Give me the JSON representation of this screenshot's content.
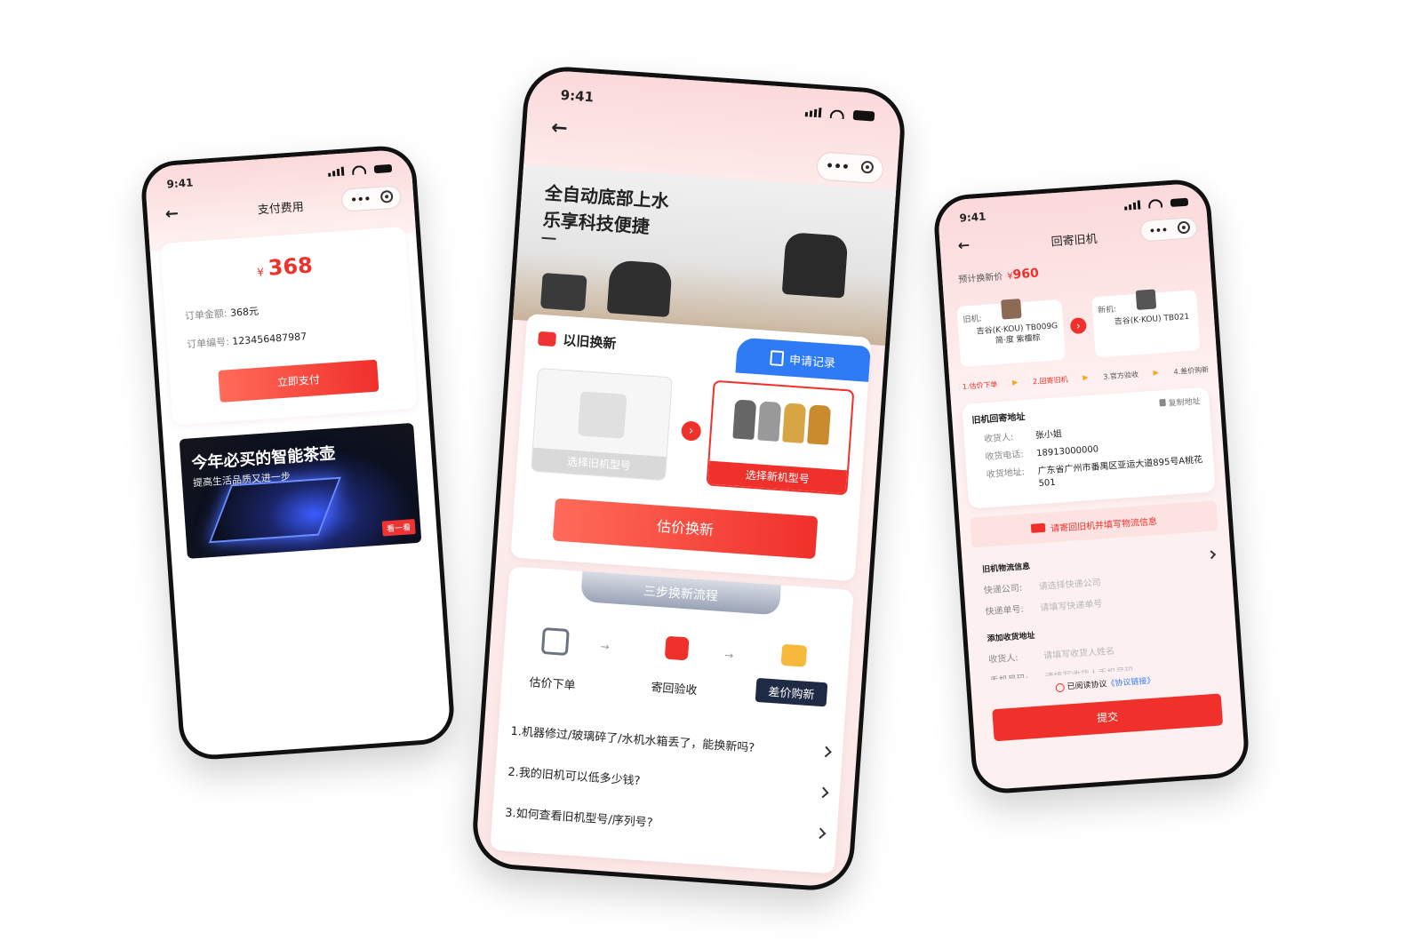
{
  "status_time": "9:41",
  "left": {
    "nav_title": "支付费用",
    "currency": "¥",
    "amount": "368",
    "order_amount_label": "订单金额:",
    "order_amount": "368元",
    "order_no_label": "订单编号:",
    "order_no": "123456487987",
    "pay_button": "立即支付",
    "banner_title": "今年必买的智能茶壶",
    "banner_subtitle": "提高生活品质又进一步",
    "banner_button": "看一看"
  },
  "mid": {
    "hero_line1": "全自动底部上水",
    "hero_line2": "乐享科技便捷",
    "trade_in_title": "以旧换新",
    "apply_record": "申请记录",
    "select_old": "选择旧机型号",
    "select_new": "选择新机型号",
    "estimate_button": "估价换新",
    "steps_title": "三步换新流程",
    "steps": [
      "估价下单",
      "寄回验收",
      "差价购新"
    ],
    "faq": [
      "1.机器修过/玻璃碎了/水机水箱丢了，能换新吗?",
      "2.我的旧机可以低多少钱?",
      "3.如何查看旧机型号/序列号?"
    ],
    "colors": {
      "accent": "#f0302a",
      "tab_blue": "#2f7bf5"
    }
  },
  "right": {
    "nav_title": "回寄旧机",
    "est_label": "预计换新价",
    "est_currency": "¥",
    "est_value": "960",
    "old_label": "旧机:",
    "old_name": "吉谷(K·KOU) TB009G 简·度 紫檀棕",
    "new_label": "新机:",
    "new_name": "吉谷(K·KOU) TB021",
    "progress": [
      "1.估价下单",
      "2.回寄旧机",
      "3.官方验收",
      "4.差价购新"
    ],
    "address_title": "旧机回寄地址",
    "copy_address": "复制地址",
    "receiver_label": "收货人:",
    "receiver": "张小姐",
    "phone_label": "收货电话:",
    "phone": "18913000000",
    "addr_label": "收货地址:",
    "addr": "广东省广州市番禺区亚运大道895号A桃花501",
    "notice": "请寄回旧机并填写物流信息",
    "logistics_title": "旧机物流信息",
    "courier_label": "快递公司:",
    "courier_placeholder": "请选择快递公司",
    "tracking_label": "快递单号:",
    "tracking_placeholder": "请填写快递单号",
    "add_address_title": "添加收货地址",
    "consignee_label": "收货人:",
    "consignee_placeholder": "请填写收货人姓名",
    "phone2_label": "手机号码:",
    "phone2_placeholder": "请填写收货人手机号码",
    "agree_text": "已阅读协议",
    "agree_link": "《协议链接》",
    "submit": "提交"
  }
}
